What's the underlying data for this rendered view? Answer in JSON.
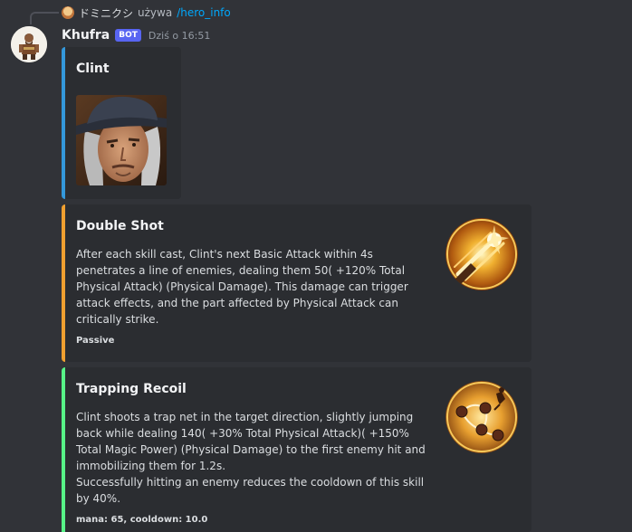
{
  "reply": {
    "user": "ドミニクシ",
    "action": "używa",
    "command": "/hero_info"
  },
  "author": {
    "name": "Khufra",
    "badge": "BOT",
    "timestamp": "Dziś o 16:51"
  },
  "embeds": [
    {
      "title": "Clint",
      "accent": "#3498db"
    },
    {
      "title": "Double Shot",
      "accent": "#f0a030",
      "description": [
        "After each skill cast, Clint's next Basic Attack within 4s penetrates a line of enemies, dealing them 50( +120% Total Physical Attack) (Physical Damage). This damage can trigger attack effects, and the part affected by Physical Attack can critically strike."
      ],
      "footer": "Passive"
    },
    {
      "title": "Trapping Recoil",
      "accent": "#57f287",
      "description": [
        "Clint shoots a trap net in the target direction, slightly jumping back while dealing 140( +30% Total Physical Attack)( +150% Total Magic Power) (Physical Damage) to the first enemy hit and immobilizing them for 1.2s.",
        "Successfully hitting an enemy reduces the cooldown of this skill by 40%."
      ],
      "footer": "mana: 65, cooldown: 10.0"
    }
  ]
}
